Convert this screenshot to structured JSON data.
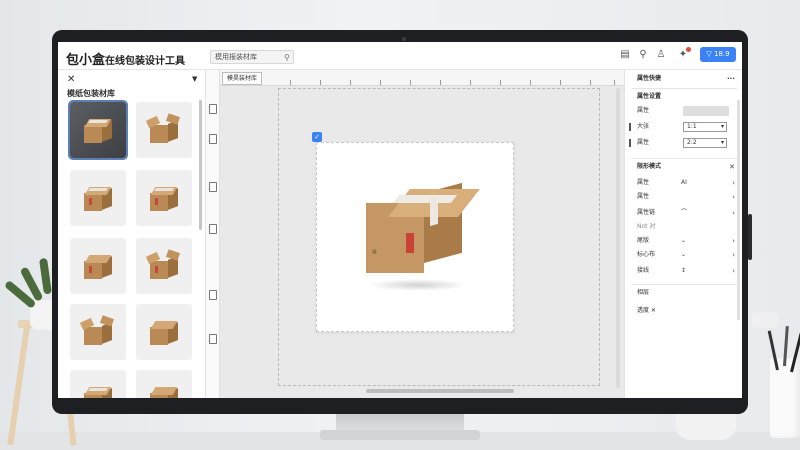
{
  "app": {
    "logo_main": "包小盒",
    "logo_sub": "在线包装设计工具"
  },
  "search": {
    "value": "模用报装材库"
  },
  "topbar_icons": [
    "template-icon",
    "search-icon",
    "user-icon",
    "notification-icon"
  ],
  "share_button": {
    "label": "▽ 18.9"
  },
  "left_panel": {
    "title": "模纸包装材库",
    "close": "✕",
    "collapse": "▼"
  },
  "canvas": {
    "tab_label": "模昊装材库",
    "check": "✓"
  },
  "right_panel": {
    "header": "属性快捷",
    "more": "···",
    "section1_title": "属性设置",
    "rows1": [
      {
        "label": "属性"
      },
      {
        "label": "大张",
        "value": "1:1"
      },
      {
        "label": "属性",
        "value": "2:2"
      }
    ],
    "section2_title": "限形模式",
    "rows2": [
      {
        "label": "属性",
        "mid": "AI",
        "arrow": "›"
      },
      {
        "label": "属性",
        "arrow": "›"
      },
      {
        "label": "属性链",
        "mid": "⌒",
        "arrow": "›"
      },
      {
        "label": "Not 对"
      },
      {
        "label": "尾版",
        "mid": "⌄",
        "arrow": "›"
      },
      {
        "label": "标心布",
        "mid": "⌄",
        "arrow": "›"
      },
      {
        "label": "接线",
        "mid": "↕",
        "arrow": "›"
      }
    ],
    "section3_title": "相层",
    "section3_row": "透度 ✕",
    "close": "✕"
  },
  "colors": {
    "accent": "#3a82f6",
    "kraft": "#c59764",
    "label_red": "#c84236"
  }
}
